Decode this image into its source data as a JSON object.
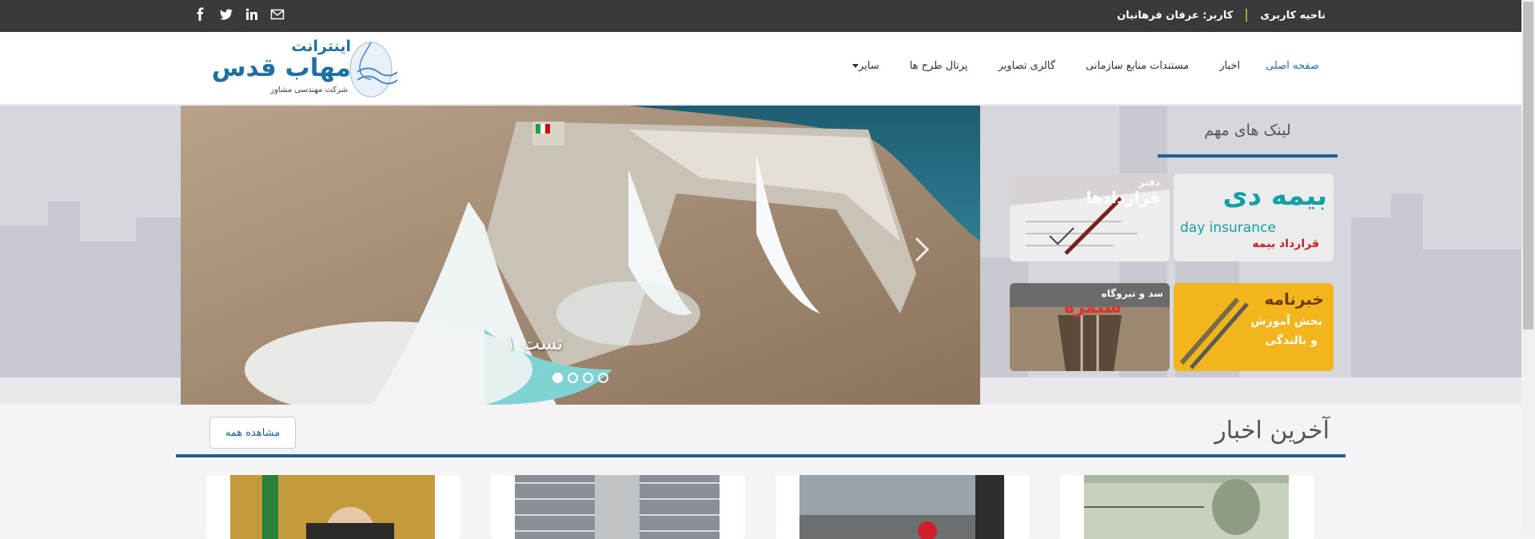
{
  "topbar": {
    "user_area": "ناحیه کاربری",
    "user_label": "کاربر: عرفان فرهانیان",
    "social_icons": [
      "email-icon",
      "linkedin-icon",
      "twitter-icon",
      "facebook-icon"
    ]
  },
  "header": {
    "logo_line1": "اینترانت",
    "logo_line2": "مهاب قدس",
    "logo_line3": "شرکت مهندسی مشاور",
    "nav": [
      {
        "label": "صفحه اصلی"
      },
      {
        "label": "اخبار"
      },
      {
        "label": "مستندات منابع سازمانی"
      },
      {
        "label": "گالری تصاویر"
      },
      {
        "label": "پرتال طرح ها"
      },
      {
        "label": "سایر"
      }
    ]
  },
  "hero": {
    "slide_caption": "تست ۱",
    "slide_count": 4,
    "active_slide": 1
  },
  "links": {
    "title": "لینک های مهم",
    "tiles": [
      {
        "line1": "بیمه دی",
        "line2": "day insurance",
        "line3": "قرارداد بیمه"
      },
      {
        "line1": "دفتر",
        "line2": "قراردادها"
      },
      {
        "line1": "خبرنامه",
        "line2": "بخش آموزش",
        "line3": "و بالندگی"
      },
      {
        "line1": "سد و نیروگاه",
        "line2": "سیمره"
      }
    ]
  },
  "news": {
    "title": "آخرین اخبار",
    "see_all": "مشاهده همه"
  },
  "colors": {
    "accent": "#1f5f95",
    "topbar": "#3a3a3a",
    "nav_active": "#1f6fa5"
  }
}
